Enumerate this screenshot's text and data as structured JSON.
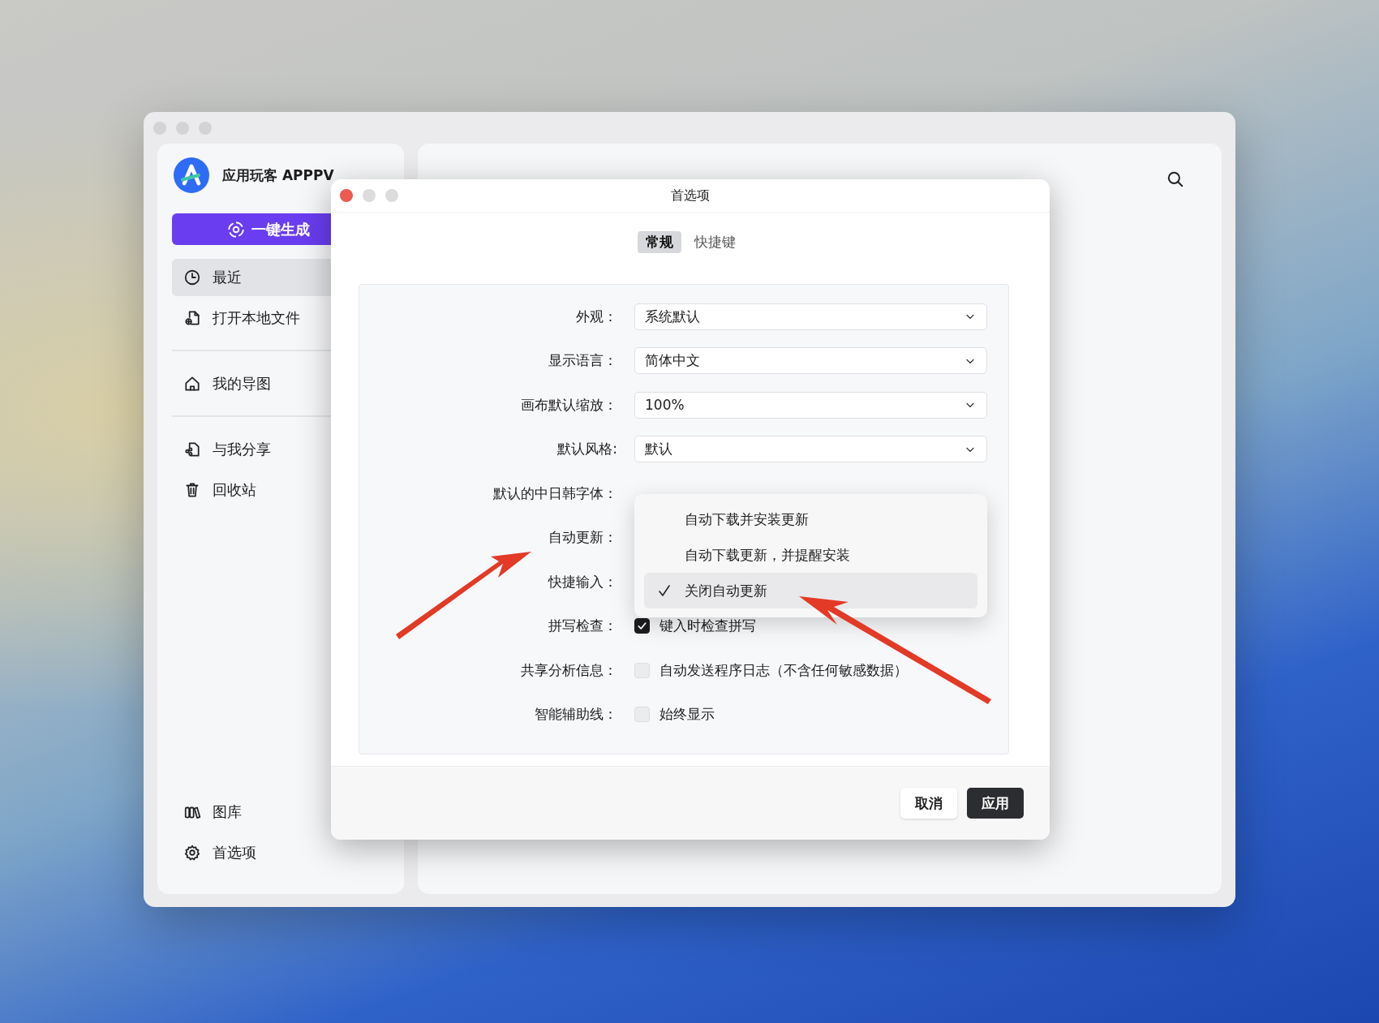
{
  "app_window": {
    "sidebar": {
      "app_name": "应用玩客 APPPV",
      "generate_button": "一键生成",
      "groups": [
        {
          "items": [
            {
              "label": "最近",
              "selected": true
            },
            {
              "label": "打开本地文件",
              "selected": false
            }
          ]
        },
        {
          "items": [
            {
              "label": "我的导图",
              "selected": false
            }
          ]
        },
        {
          "items": [
            {
              "label": "与我分享",
              "selected": false
            },
            {
              "label": "回收站",
              "selected": false
            }
          ]
        }
      ],
      "bottom_items": [
        {
          "label": "图库",
          "selected": false
        },
        {
          "label": "首选项",
          "selected": false
        }
      ]
    }
  },
  "dialog": {
    "title": "首选项",
    "tabs": [
      {
        "label": "常规",
        "selected": true
      },
      {
        "label": "快捷键",
        "selected": false
      }
    ],
    "settings": [
      {
        "kind": "select",
        "label": "外观：",
        "value": "系统默认"
      },
      {
        "kind": "select",
        "label": "显示语言：",
        "value": "简体中文"
      },
      {
        "kind": "select",
        "label": "画布默认缩放：",
        "value": "100%"
      },
      {
        "kind": "select",
        "label": "默认风格:",
        "value": "默认"
      },
      {
        "kind": "select",
        "label": "默认的中日韩字体："
      },
      {
        "kind": "select",
        "label": "自动更新："
      },
      {
        "kind": "select",
        "label": "快捷输入："
      },
      {
        "kind": "checkbox",
        "label": "拼写检查：",
        "text": "键入时检查拼写",
        "checked": true
      },
      {
        "kind": "checkbox",
        "label": "共享分析信息：",
        "text": "自动发送程序日志（不含任何敏感数据）",
        "checked": false
      },
      {
        "kind": "checkbox",
        "label": "智能辅助线：",
        "text": "始终显示",
        "checked": false
      }
    ],
    "dropdown": {
      "options": [
        {
          "label": "自动下载并安装更新",
          "selected": false
        },
        {
          "label": "自动下载更新，并提醒安装",
          "selected": false
        },
        {
          "label": "关闭自动更新",
          "selected": true
        }
      ]
    },
    "buttons": [
      {
        "label": "取消",
        "kind": "secondary"
      },
      {
        "label": "应用",
        "kind": "primary"
      }
    ]
  }
}
